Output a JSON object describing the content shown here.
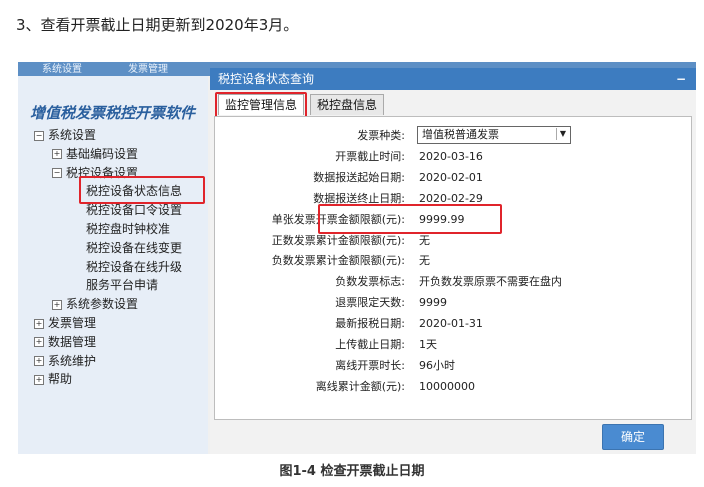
{
  "step_text": "3、查看开票截止日期更新到2020年3月。",
  "app": {
    "top_tabs": [
      "系统设置",
      "发票管理"
    ],
    "brand": "增值税发票税控开票软件"
  },
  "tree": [
    {
      "label": "系统设置",
      "level": 0,
      "toggle": "−"
    },
    {
      "label": "基础编码设置",
      "level": 1,
      "toggle": "+"
    },
    {
      "label": "税控设备设置",
      "level": 1,
      "toggle": "−"
    },
    {
      "label": "税控设备状态信息",
      "level": 2,
      "toggle": ""
    },
    {
      "label": "税控设备口令设置",
      "level": 2,
      "toggle": ""
    },
    {
      "label": "税控盘时钟校准",
      "level": 2,
      "toggle": ""
    },
    {
      "label": "税控设备在线变更",
      "level": 2,
      "toggle": ""
    },
    {
      "label": "税控设备在线升级",
      "level": 2,
      "toggle": ""
    },
    {
      "label": "服务平台申请",
      "level": 2,
      "toggle": ""
    },
    {
      "label": "系统参数设置",
      "level": 1,
      "toggle": "+"
    },
    {
      "label": "发票管理",
      "level": 0,
      "toggle": "+"
    },
    {
      "label": "数据管理",
      "level": 0,
      "toggle": "+"
    },
    {
      "label": "系统维护",
      "level": 0,
      "toggle": "+"
    },
    {
      "label": "帮助",
      "level": 0,
      "toggle": "+"
    }
  ],
  "dialog": {
    "title": "税控设备状态查询",
    "minimize": "−",
    "tabs": [
      "监控管理信息",
      "税控盘信息"
    ],
    "ok_label": "确定"
  },
  "fields": [
    {
      "label": "发票种类:",
      "value": "增值税普通发票",
      "type": "select"
    },
    {
      "label": "开票截止时间:",
      "value": "2020-03-16"
    },
    {
      "label": "数据报送起始日期:",
      "value": "2020-02-01"
    },
    {
      "label": "数据报送终止日期:",
      "value": "2020-02-29"
    },
    {
      "label": "单张发票开票金额限额(元):",
      "value": "9999.99"
    },
    {
      "label": "正数发票累计金额限额(元):",
      "value": "无"
    },
    {
      "label": "负数发票累计金额限额(元):",
      "value": "无"
    },
    {
      "label": "负数发票标志:",
      "value": "开负数发票原票不需要在盘内"
    },
    {
      "label": "退票限定天数:",
      "value": "9999"
    },
    {
      "label": "最新报税日期:",
      "value": "2020-01-31"
    },
    {
      "label": "上传截止日期:",
      "value": "1天"
    },
    {
      "label": "离线开票时长:",
      "value": "96小时"
    },
    {
      "label": "离线累计金额(元):",
      "value": "10000000"
    }
  ],
  "caption": "图1-4 检查开票截止日期",
  "colors": {
    "highlight": "#e0242b",
    "title_bar": "#3d7cc0",
    "ok_button": "#4a8bd1"
  }
}
